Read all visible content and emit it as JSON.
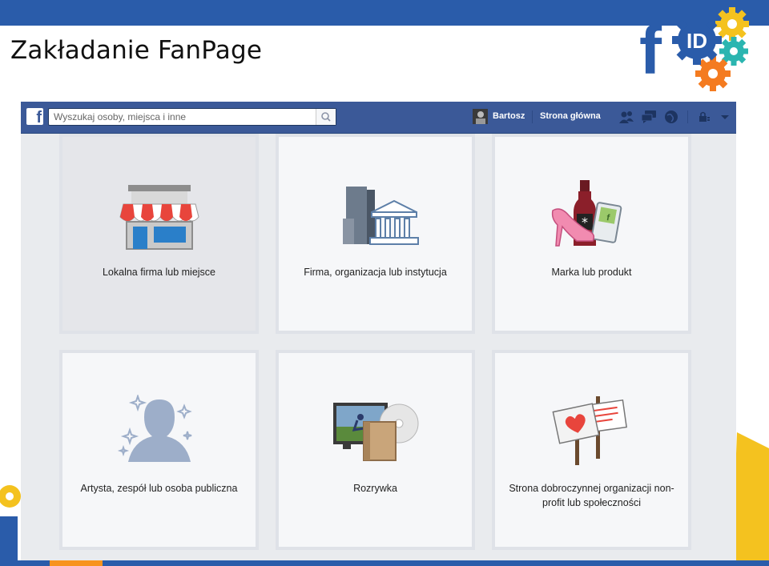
{
  "slide": {
    "title": "Zakładanie FanPage",
    "logo_letters": "f",
    "logo_badge": "ID"
  },
  "colors": {
    "slide_bar": "#2a5caa",
    "fb_blue": "#3b5998",
    "card_bg": "#f6f7f9",
    "accent_orange": "#f7931e",
    "accent_yellow": "#f4c21f",
    "accent_teal": "#2bb5b0"
  },
  "facebook": {
    "logo": "f",
    "search": {
      "placeholder": "Wyszukaj osoby, miejsca i inne",
      "icon": "search-icon"
    },
    "user_name": "Bartosz",
    "home_link": "Strona główna",
    "icons": [
      "friend-requests-icon",
      "messages-icon",
      "notifications-icon",
      "privacy-shortcuts-icon",
      "account-menu-chevron-icon"
    ]
  },
  "categories": [
    {
      "label": "Lokalna firma lub miejsce",
      "icon": "storefront-icon"
    },
    {
      "label": "Firma, organizacja lub instytucja",
      "icon": "buildings-icon"
    },
    {
      "label": "Marka lub produkt",
      "icon": "products-icon"
    },
    {
      "label": "Artysta, zespół lub osoba publiczna",
      "icon": "public-figure-icon"
    },
    {
      "label": "Rozrywka",
      "icon": "entertainment-icon"
    },
    {
      "label": "Strona dobroczynnej organizacji non-profit lub społeczności",
      "icon": "community-signs-icon"
    }
  ]
}
